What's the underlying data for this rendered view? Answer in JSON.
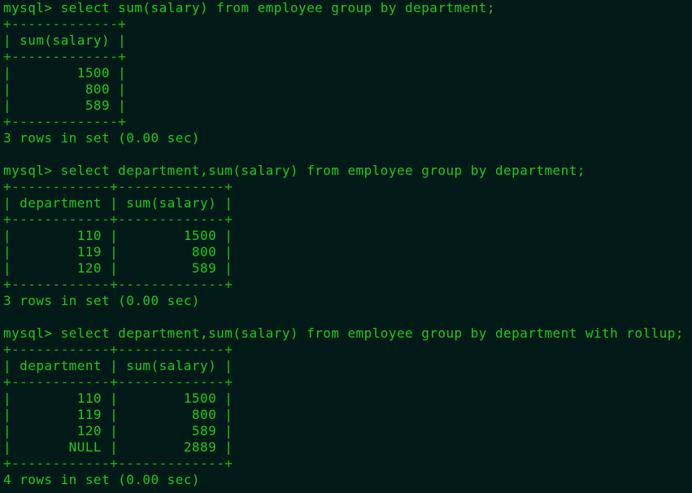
{
  "terminal": {
    "lines": [
      "mysql> select sum(salary) from employee group by department;",
      "+-------------+",
      "| sum(salary) |",
      "+-------------+",
      "|        1500 |",
      "|         800 |",
      "|         589 |",
      "+-------------+",
      "3 rows in set (0.00 sec)",
      "",
      "mysql> select department,sum(salary) from employee group by department;",
      "+------------+-------------+",
      "| department | sum(salary) |",
      "+------------+-------------+",
      "|        110 |        1500 |",
      "|        119 |         800 |",
      "|        120 |         589 |",
      "+------------+-------------+",
      "3 rows in set (0.00 sec)",
      "",
      "mysql> select department,sum(salary) from employee group by department with rollup;",
      "+------------+-------------+",
      "| department | sum(salary) |",
      "+------------+-------------+",
      "|        110 |        1500 |",
      "|        119 |         800 |",
      "|        120 |         589 |",
      "|       NULL |        2889 |",
      "+------------+-------------+",
      "4 rows in set (0.00 sec)"
    ]
  }
}
